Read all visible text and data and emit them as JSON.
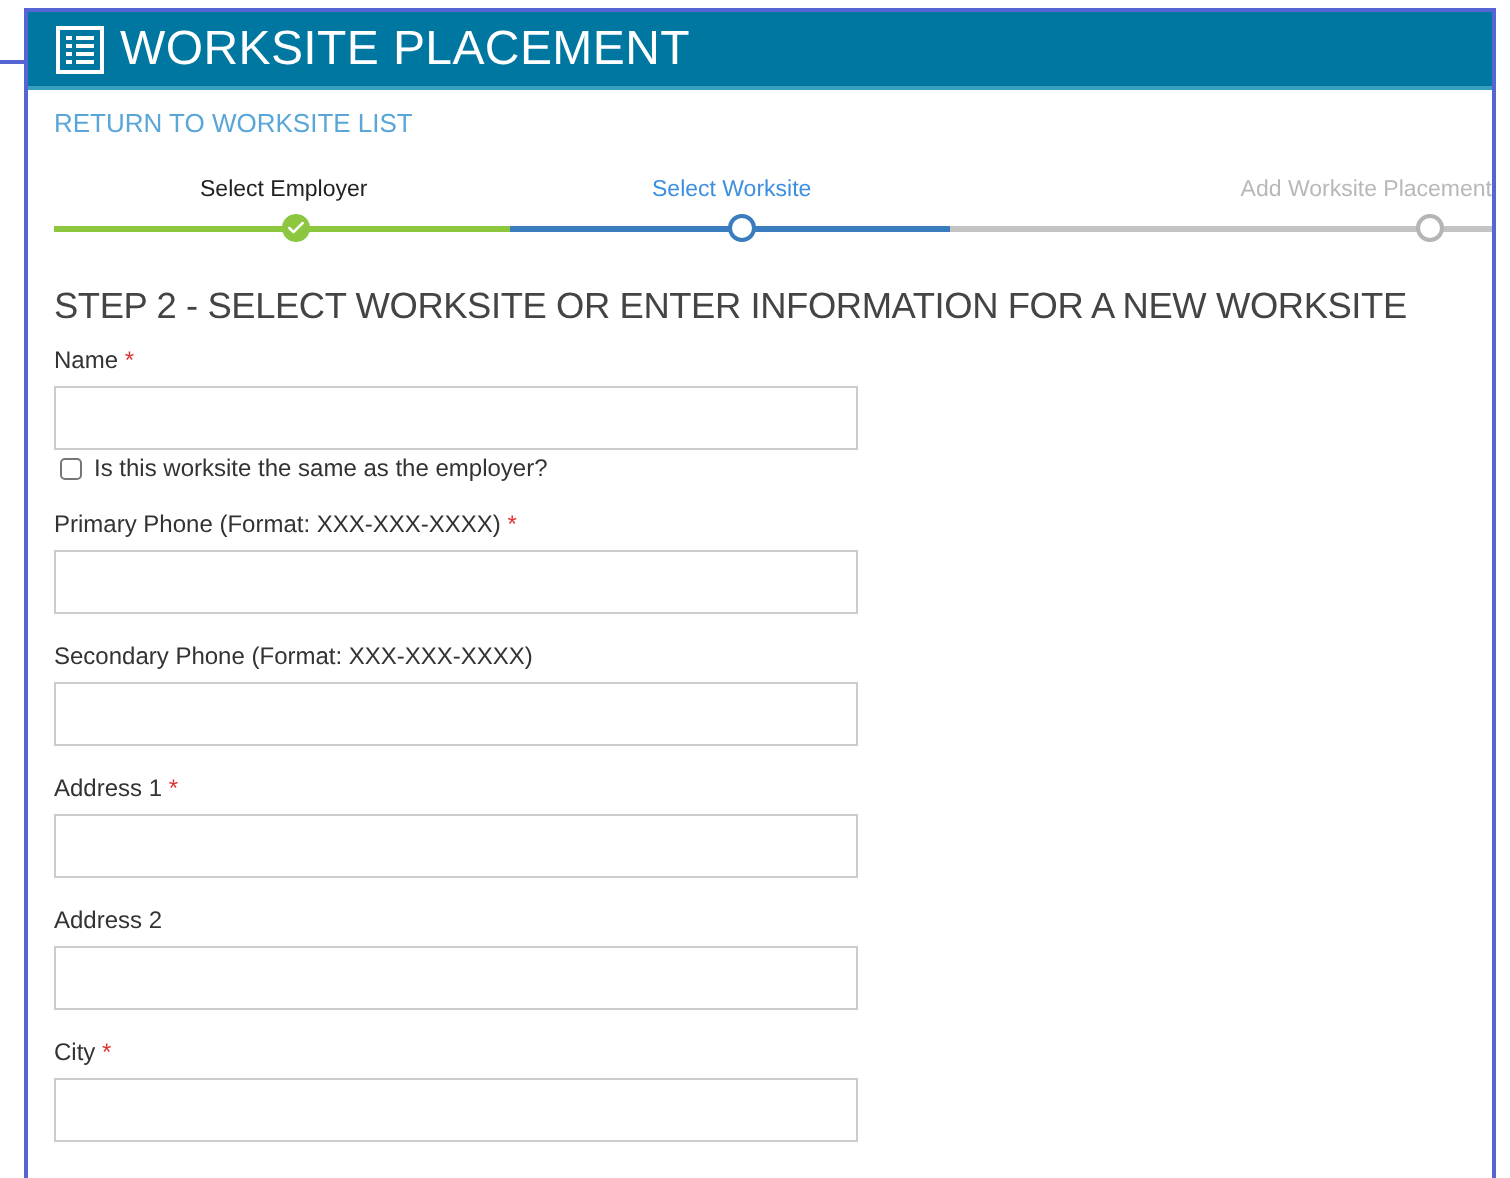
{
  "header": {
    "title": "WORKSITE PLACEMENT"
  },
  "return_link": "RETURN TO WORKSITE LIST",
  "steps": [
    {
      "label": "Select Employer",
      "kind": "done"
    },
    {
      "label": "Select Worksite",
      "kind": "current"
    },
    {
      "label": "Add Worksite Placement",
      "kind": "todo"
    }
  ],
  "heading": "STEP 2 - SELECT WORKSITE OR ENTER INFORMATION FOR A NEW WORKSITE",
  "fields": [
    {
      "kind": "input",
      "label": "Name",
      "required": true
    },
    {
      "kind": "checkbox",
      "label": "Is this worksite the same as the employer?",
      "checked": false
    },
    {
      "kind": "input",
      "label": "Primary Phone (Format: XXX-XXX-XXXX)",
      "required": true
    },
    {
      "kind": "input",
      "label": "Secondary Phone (Format: XXX-XXX-XXXX)",
      "required": false
    },
    {
      "kind": "input",
      "label": "Address 1",
      "required": true
    },
    {
      "kind": "input",
      "label": "Address 2",
      "required": false
    },
    {
      "kind": "input",
      "label": "City",
      "required": true
    }
  ],
  "required_mark": "*"
}
